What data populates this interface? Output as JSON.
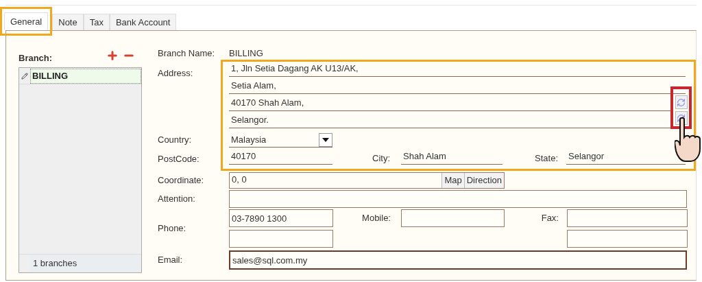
{
  "tabs": [
    {
      "label": "General",
      "selected": true
    },
    {
      "label": "Note",
      "selected": false
    },
    {
      "label": "Tax",
      "selected": false
    },
    {
      "label": "Bank Account",
      "selected": false
    }
  ],
  "branch_panel": {
    "label": "Branch:",
    "items": [
      {
        "name": "BILLING",
        "selected": true
      }
    ],
    "footer": "1 branches"
  },
  "form": {
    "branch_name": {
      "label": "Branch Name:",
      "value": "BILLING"
    },
    "address": {
      "label": "Address:",
      "lines": [
        "1, Jln Setia Dagang AK U13/AK,",
        "Setia Alam,",
        "40170 Shah Alam,",
        "Selangor."
      ]
    },
    "country": {
      "label": "Country:",
      "value": "Malaysia"
    },
    "postcode": {
      "label": "PostCode:",
      "value": "40170"
    },
    "city": {
      "label": "City:",
      "value": "Shah Alam"
    },
    "state": {
      "label": "State:",
      "value": "Selangor"
    },
    "coordinate": {
      "label": "Coordinate:",
      "value": "0, 0",
      "buttons": [
        "Map",
        "Direction"
      ]
    },
    "attention": {
      "label": "Attention:"
    },
    "phone": {
      "label": "Phone:",
      "fields": [
        {
          "kind": "box",
          "value": "03-7890 1300"
        },
        {
          "kind": "box"
        }
      ]
    },
    "mobile": {
      "label": "Mobile:"
    },
    "fax": {
      "label": "Fax:",
      "fields": [
        {
          "kind": "box"
        },
        {
          "kind": "box"
        }
      ]
    },
    "email": {
      "label": "Email:",
      "value": "sales@sql.com.my",
      "focused": true
    }
  }
}
